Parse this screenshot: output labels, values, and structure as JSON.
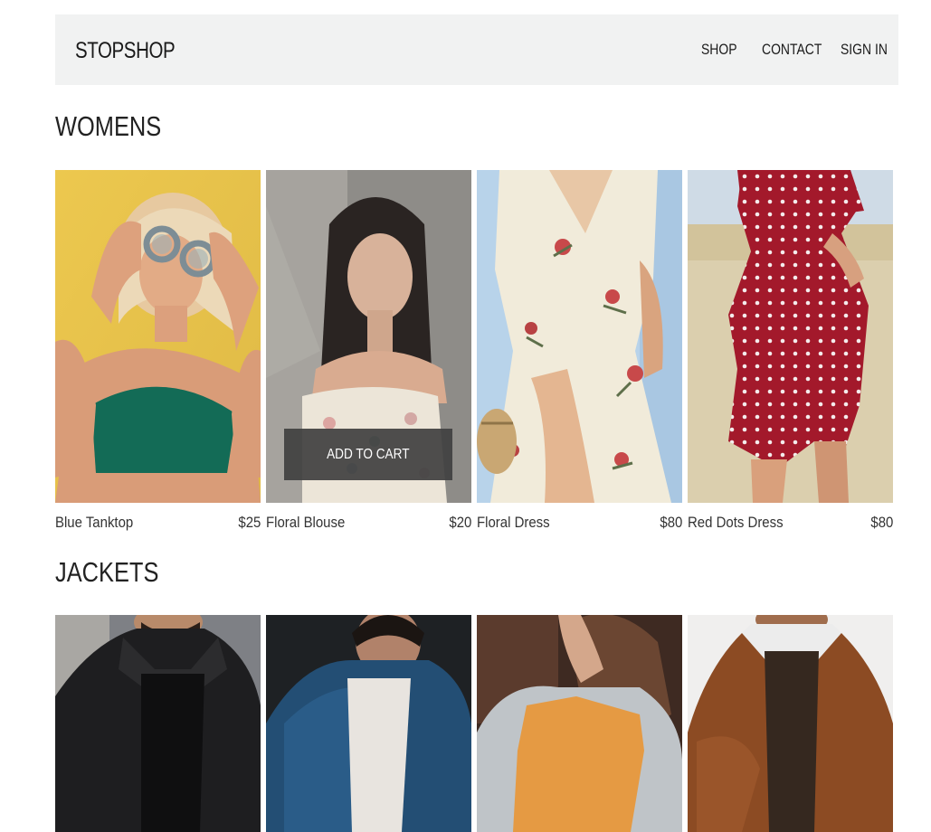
{
  "header": {
    "logo": "STOPSHOP",
    "nav": {
      "shop": "SHOP",
      "contact": "CONTACT",
      "sign_in": "SIGN IN"
    }
  },
  "sections": {
    "womens": {
      "title": "WOMENS",
      "items": [
        {
          "name": "Blue Tanktop",
          "price": "$25"
        },
        {
          "name": "Floral Blouse",
          "price": "$20",
          "hover_button": "ADD TO CART"
        },
        {
          "name": "Floral Dress",
          "price": "$80"
        },
        {
          "name": "Red Dots Dress",
          "price": "$80"
        }
      ]
    },
    "jackets": {
      "title": "JACKETS"
    }
  },
  "colors": {
    "header_bg": "#f1f2f2",
    "overlay": "#404040",
    "text": "#1a1a1a"
  }
}
